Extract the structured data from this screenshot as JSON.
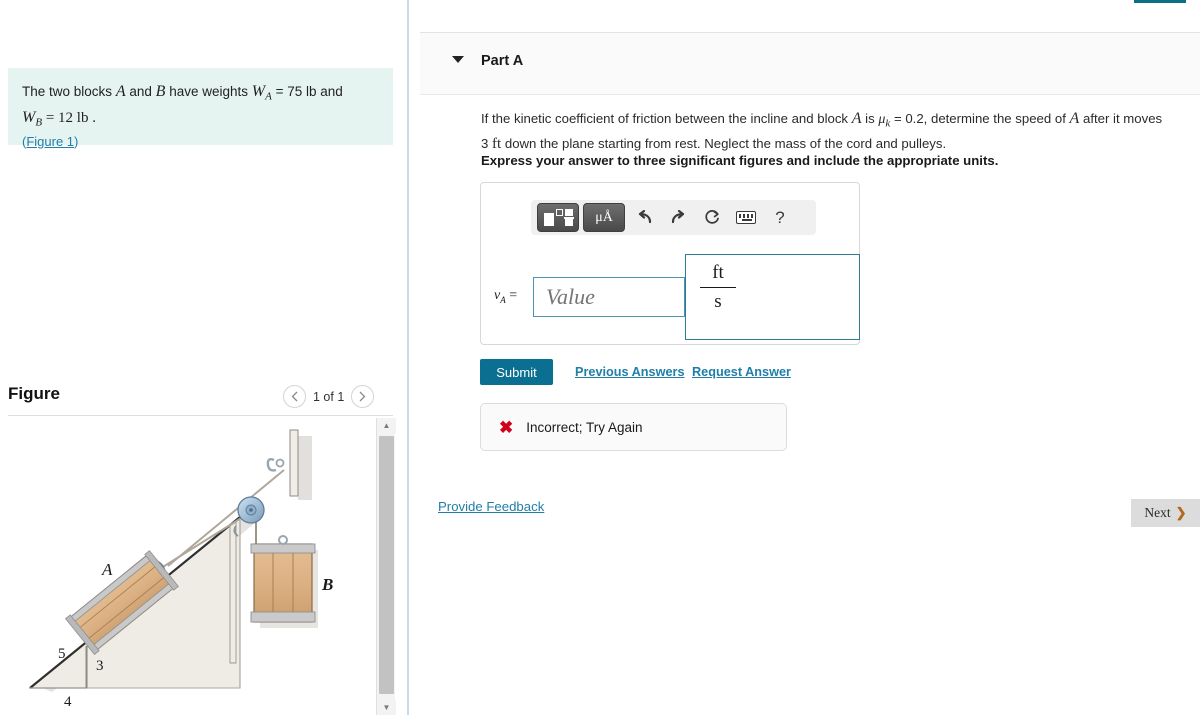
{
  "problem": {
    "text_1": "The two blocks",
    "var_a": "A",
    "text_2": "and",
    "var_b": "B",
    "text_3": "have weights",
    "wa_sym": "W",
    "wa_sub": "A",
    "wa_val": "= 75 lb and",
    "wb_sym": "W",
    "wb_sub": "B",
    "wb_val": "= 12 lb .",
    "figure_link_open": "(",
    "figure_link": "Figure 1",
    "figure_link_close": ")"
  },
  "figure": {
    "title": "Figure",
    "prev_icon": "chevron-left-icon",
    "next_icon": "chevron-right-icon",
    "pager_label": "1 of 1",
    "labels": {
      "block_a": "A",
      "block_b": "B",
      "hyp": "5",
      "rise": "3",
      "run": "4"
    }
  },
  "part": {
    "caret_icon": "caret-down-icon",
    "title": "Part A",
    "question": "If the kinetic coefficient of friction between the incline and block A is μk = 0.2, determine the speed of A after it moves 3 ft down the plane starting from rest. Neglect the mass of the cord and pulleys.",
    "question_pre": "If the kinetic coefficient of friction between the incline and block",
    "question_var_a1": "A",
    "question_mid1": "is",
    "question_mu": "μ",
    "question_mu_sub": "k",
    "question_mid2": "= 0.2, determine the speed of",
    "question_var_a2": "A",
    "question_mid3": "after it moves 3",
    "question_ft": "ft",
    "question_end": "down the plane starting from rest. Neglect the mass of the cord and pulleys.",
    "instruction": "Express your answer to three significant figures and include the appropriate units."
  },
  "answer": {
    "toolbar": [
      {
        "name": "template-shapes-button",
        "icon": "shapes-icon",
        "label": ""
      },
      {
        "name": "units-button",
        "icon": "micro-angstrom-icon",
        "label": "μÅ"
      },
      {
        "name": "undo-button",
        "icon": "undo-arrow-icon",
        "label": "↰"
      },
      {
        "name": "redo-button",
        "icon": "redo-arrow-icon",
        "label": "↱"
      },
      {
        "name": "reset-button",
        "icon": "refresh-circular-arrow-icon",
        "label": "↻"
      },
      {
        "name": "keyboard-button",
        "icon": "keyboard-icon",
        "label": ""
      },
      {
        "name": "help-button",
        "icon": "question-mark-icon",
        "label": "?"
      }
    ],
    "variable_symbol": "v",
    "variable_subscript": "A",
    "equals": "=",
    "value_placeholder": "Value",
    "unit_numerator": "ft",
    "unit_denominator": "s"
  },
  "actions": {
    "submit_label": "Submit",
    "previous_answers_label": "Previous Answers",
    "request_answer_label": "Request Answer",
    "provide_feedback_label": "Provide Feedback",
    "next_label": "Next",
    "next_chevron": "❯"
  },
  "feedback": {
    "icon": "x-mark-icon",
    "icon_glyph": "✖",
    "message": "Incorrect; Try Again",
    "color": "#d0021b"
  },
  "colors": {
    "accent_teal": "#0a6f91",
    "link_blue": "#1f7fa8",
    "panel_mint": "#e6f4f1",
    "error_red": "#d0021b",
    "input_border": "#4b95ae"
  }
}
